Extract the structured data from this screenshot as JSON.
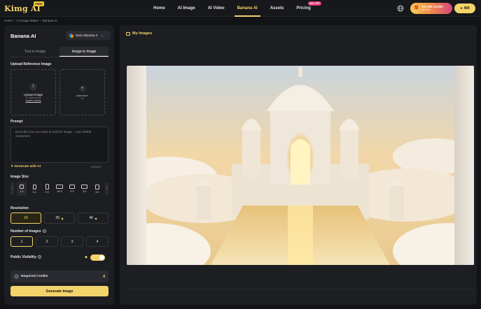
{
  "header": {
    "logo": "Kimg AI",
    "logo_tag": "FREE",
    "nav": [
      {
        "label": "Home"
      },
      {
        "label": "AI Image"
      },
      {
        "label": "AI Video"
      },
      {
        "label": "Banana AI"
      },
      {
        "label": "Assets"
      },
      {
        "label": "Pricing",
        "tag": "50% OFF"
      }
    ],
    "active_nav": "Banana AI",
    "promo_line1": "Get 400 credits",
    "promo_line2": "for Free",
    "credits": "400"
  },
  "breadcrumb": [
    "Home",
    "›",
    "AI Image Maker",
    "›",
    "Banana AI"
  ],
  "panel": {
    "title": "Banana AI",
    "model": "Nano Banana 2",
    "tabs": [
      "Text to Image",
      "Image to Image"
    ],
    "active_tab": "Image to Image",
    "upload_label": "Upload Reference Image",
    "upload": {
      "title": "Upload Image",
      "subtitle": "Or Select from",
      "link": "Assets Library"
    },
    "add_more": {
      "title": "Add more",
      "count": "1/3"
    },
    "prompt_label": "Prompt",
    "prompt_placeholder": "Describe how you want to edit the image... max 20000 characters",
    "generate_ai": "Generate with AI",
    "char_count": "0/20000",
    "size_label": "Image Size",
    "sizes": [
      "1:1",
      "3:4",
      "2:3",
      "16:9",
      "4:3",
      "3:2",
      "4:5"
    ],
    "resolution_label": "Resolution",
    "resolutions": [
      "1K",
      "2K",
      "4K"
    ],
    "num_label": "Number of Images",
    "nums": [
      "1",
      "2",
      "3",
      "4"
    ],
    "visibility_label": "Public Visibility",
    "visibility_on": true,
    "required_label": "Required Credits",
    "required_value": "4",
    "generate_button": "Generate Image"
  },
  "gallery": {
    "title": "My Images"
  }
}
